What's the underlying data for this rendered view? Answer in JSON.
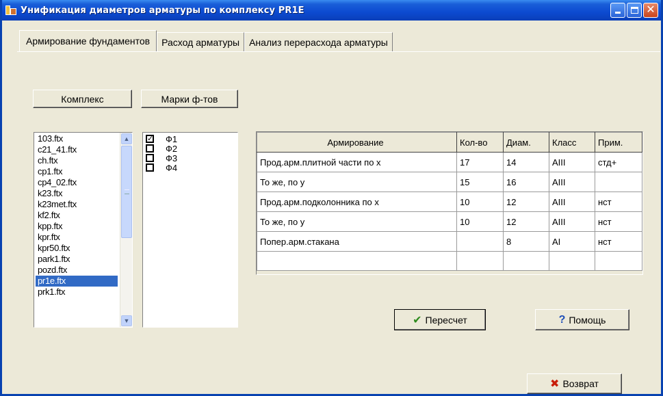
{
  "window": {
    "title": "Унификация диаметров арматуры по комплексу  PR1E"
  },
  "tabs": [
    {
      "label": "Армирование фундаментов",
      "active": true
    },
    {
      "label": "Расход арматуры",
      "active": false
    },
    {
      "label": "Анализ перерасхода арматуры",
      "active": false
    }
  ],
  "buttons": {
    "complex": "Комплекс",
    "marks": "Марки ф-тов",
    "recalc": "Пересчет",
    "help": "Помощь",
    "back": "Возврат"
  },
  "icons": {
    "recalc": "checkmark-icon",
    "help": "question-mark-icon",
    "back": "cross-icon"
  },
  "colors": {
    "title_bar": "#0c4ad0",
    "selection": "#316ac5",
    "check_icon": "#2e8b1e",
    "help_icon": "#1f4fb8",
    "back_icon": "#c81e0a"
  },
  "file_list": {
    "items": [
      "103.ftx",
      "c21_41.ftx",
      "ch.ftx",
      "cp1.ftx",
      "cp4_02.ftx",
      "k23.ftx",
      "k23met.ftx",
      "kf2.ftx",
      "kpp.ftx",
      "kpr.ftx",
      "kpr50.ftx",
      "park1.ftx",
      "pozd.ftx",
      "pr1e.ftx",
      "prk1.ftx"
    ],
    "selected": "pr1e.ftx"
  },
  "marks_list": [
    {
      "label": "Ф1",
      "checked": true
    },
    {
      "label": "Ф2",
      "checked": false
    },
    {
      "label": "Ф3",
      "checked": false
    },
    {
      "label": "Ф4",
      "checked": false
    }
  ],
  "reinforcement_table": {
    "headers": [
      "Армирование",
      "Кол-во",
      "Диам.",
      "Класс",
      "Прим."
    ],
    "rows": [
      [
        "Прод.арм.плитной части по х",
        "17",
        "14",
        "AIII",
        "стд+"
      ],
      [
        "То же, по у",
        "15",
        "16",
        "AIII",
        ""
      ],
      [
        "Прод.арм.подколонника по х",
        "10",
        "12",
        "AIII",
        "нст"
      ],
      [
        "То же, по у",
        "10",
        "12",
        "AIII",
        "нст"
      ],
      [
        "Попер.арм.стакана",
        "",
        "8",
        "AI",
        "нст"
      ],
      [
        "",
        "",
        "",
        "",
        ""
      ]
    ]
  }
}
